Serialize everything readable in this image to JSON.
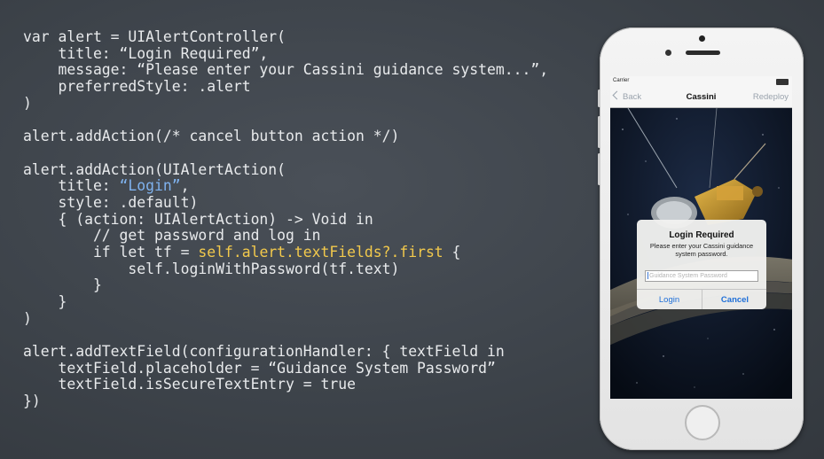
{
  "code": {
    "lines": [
      [
        {
          "t": "var alert = UIAlertController("
        }
      ],
      [
        {
          "t": "    title: “Login Required”,"
        }
      ],
      [
        {
          "t": "    message: “Please enter your Cassini guidance system...”,"
        }
      ],
      [
        {
          "t": "    preferredStyle: .alert"
        }
      ],
      [
        {
          "t": ")"
        }
      ],
      [
        {
          "t": ""
        }
      ],
      [
        {
          "t": "alert.addAction(/* cancel button action */)"
        }
      ],
      [
        {
          "t": ""
        }
      ],
      [
        {
          "t": "alert.addAction(UIAlertAction("
        }
      ],
      [
        {
          "t": "    title: "
        },
        {
          "t": "“Login”",
          "c": "blue"
        },
        {
          "t": ","
        }
      ],
      [
        {
          "t": "    style: .default)"
        }
      ],
      [
        {
          "t": "    { (action: UIAlertAction) -> Void in"
        }
      ],
      [
        {
          "t": "        // get password and log in"
        }
      ],
      [
        {
          "t": "        if let tf = "
        },
        {
          "t": "self.alert.textFields?.first",
          "c": "yellow"
        },
        {
          "t": " {"
        }
      ],
      [
        {
          "t": "            self.loginWithPassword(tf.text)"
        }
      ],
      [
        {
          "t": "        }"
        }
      ],
      [
        {
          "t": "    }"
        }
      ],
      [
        {
          "t": ")"
        }
      ],
      [
        {
          "t": ""
        }
      ],
      [
        {
          "t": "alert.addTextField(configurationHandler: { textField in"
        }
      ],
      [
        {
          "t": "    textField.placeholder = “Guidance System Password”"
        }
      ],
      [
        {
          "t": "    textField.isSecureTextEntry = true"
        }
      ],
      [
        {
          "t": "})"
        }
      ]
    ]
  },
  "phone": {
    "status": {
      "carrier": "Carrier"
    },
    "navbar": {
      "back_label": "Back",
      "title": "Cassini",
      "right_label": "Redeploy"
    },
    "alert": {
      "title": "Login Required",
      "message": "Please enter your Cassini guidance system password.",
      "field_placeholder": "Guidance System Password",
      "login_label": "Login",
      "cancel_label": "Cancel"
    }
  },
  "colors": {
    "background": "#3d434a",
    "code_text": "#e8eaec",
    "highlight_blue": "#7fb2ee",
    "highlight_yellow": "#f2c94c",
    "ios_tint": "#1e6fd8"
  }
}
